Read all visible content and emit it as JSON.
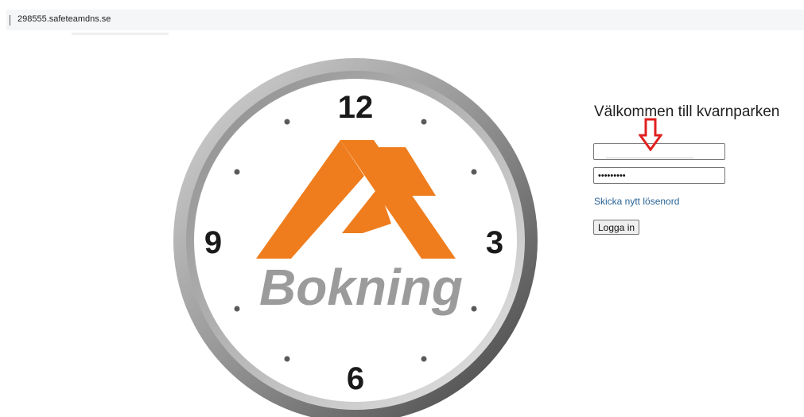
{
  "browser": {
    "url": "298555.safeteamdns.se"
  },
  "logo": {
    "clock_numbers": {
      "twelve": "12",
      "three": "3",
      "six": "6",
      "nine": "9"
    },
    "brand_text": "Bokning",
    "colors": {
      "orange": "#ef7d1d",
      "gray": "#9b9b9b",
      "bezel": "#8f8f8f"
    }
  },
  "login": {
    "welcome_text": "Välkommen till kvarnparken",
    "username_value": "",
    "password_value": "•••••••••",
    "reset_link": "Skicka nytt lösenord",
    "login_button": "Logga in"
  },
  "annotation": {
    "arrow_color": "#e02020",
    "arrow_icon": "down-arrow-outline-icon"
  }
}
